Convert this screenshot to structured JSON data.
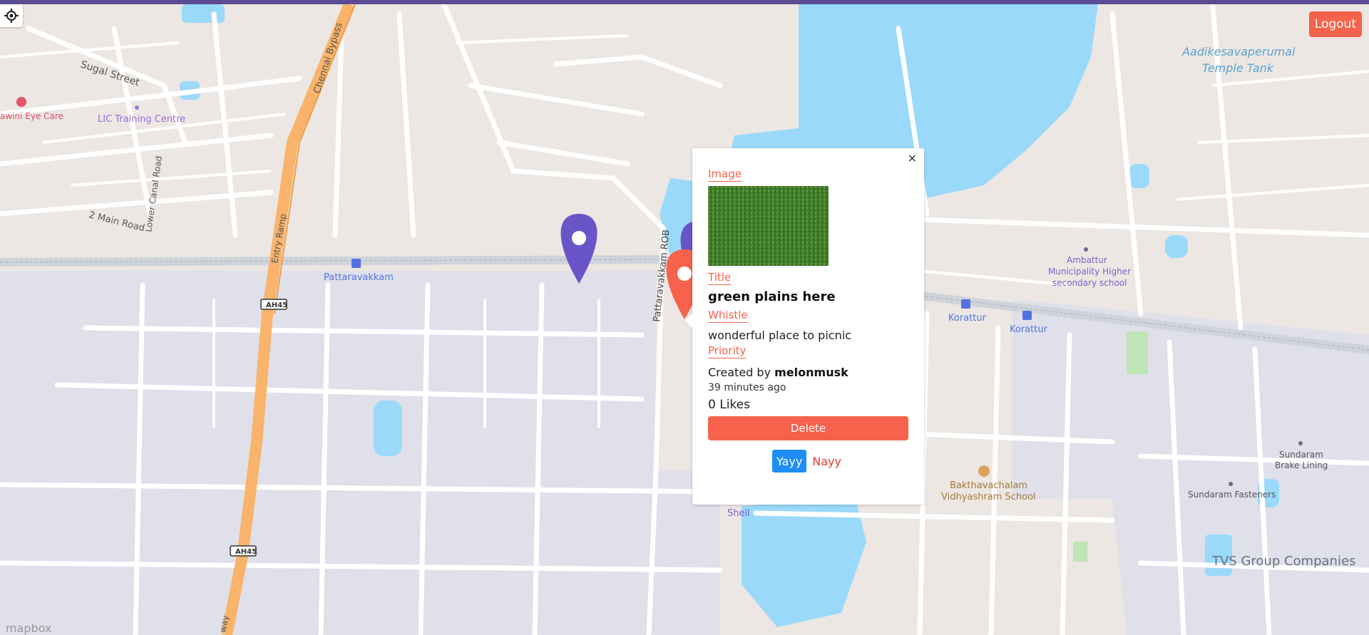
{
  "header": {
    "accent_color": "#5b4b93"
  },
  "controls": {
    "locate_icon": "crosshair-icon",
    "logout_label": "Logout"
  },
  "map": {
    "labels": {
      "sugal_street": "Sugal Street",
      "eye_care": "awini Eye Care",
      "lic": "LIC Training Centre",
      "chennai_bypass": "Chennai Bypass",
      "lower_canal_road": "Lower Canal Road",
      "main_road": "2 Main Road",
      "entry_ramp": "Entry Ramp",
      "pattaravakkam": "Pattaravakkam",
      "ah45_a": "AH45",
      "ah45_b": "AH45",
      "pattaravakkam_rob": "Pattaravakkam ROB",
      "aadikesava_line1": "Aadikesavaperumal",
      "aadikesava_line2": "Temple Tank",
      "ambattur_line1": "Ambattur",
      "ambattur_line2": "Municipality Higher",
      "ambattur_line3": "secondary school",
      "korattur_a": "Korattur",
      "korattur_b": "Korattur",
      "shell": "Shell",
      "bakthavachalam_line1": "Bakthavachalam",
      "bakthavachalam_line2": "Vidhyashram School",
      "sundaram_brake_line1": "Sundaram",
      "sundaram_brake_line2": "Brake Lining",
      "sundaram_fasteners": "Sundaram Fasteners",
      "tvs": "TVS Group Companies",
      "highway_bottom": "way",
      "mapbox": "mapbox"
    },
    "pin_colors": {
      "purple": "#6a55c8",
      "red": "#f6624b"
    }
  },
  "popup": {
    "close_label": "×",
    "image_label": "Image",
    "title_label": "Title",
    "title": "green plains here",
    "whistle_label": "Whistle",
    "description": "wonderful place to picnic",
    "priority_label": "Priority",
    "created_prefix": "Created by",
    "author": "melonmusk",
    "time_ago": "39 minutes ago",
    "likes": "0 Likes",
    "delete_label": "Delete",
    "yay_label": "Yayy",
    "nay_label": "Nayy"
  }
}
